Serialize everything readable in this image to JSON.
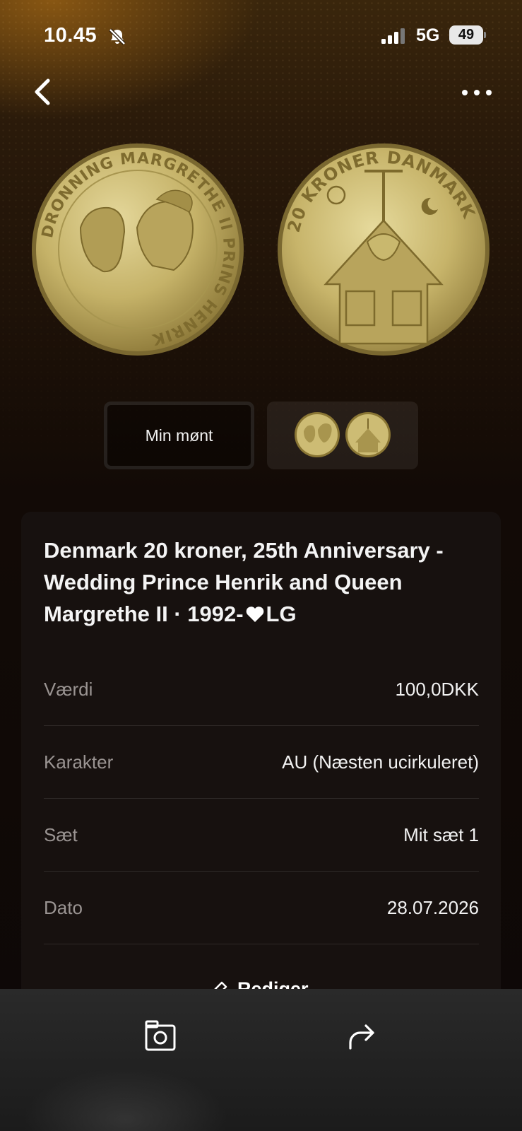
{
  "status_bar": {
    "time": "10.45",
    "network": "5G",
    "battery": "49",
    "icons": [
      "bell-slash-icon",
      "signal-icon",
      "battery-icon"
    ]
  },
  "nav": {
    "icons": [
      "chevron-left-icon",
      "ellipsis-icon"
    ]
  },
  "coin_images": {
    "obverse_inscription": "DRONNING MARGRETHE II PRINS HENRIK",
    "reverse_inscription": "20 KRONER DANMARK"
  },
  "toggle": {
    "my_coin_label": "Min mønt"
  },
  "coin": {
    "title_part1": "Denmark 20 kroner, 25th Anniversary - Wedding Prince Henrik and Queen Margrethe II · 1992-",
    "title_part2": "LG",
    "details": [
      {
        "label": "Værdi",
        "value": "100,0DKK"
      },
      {
        "label": "Karakter",
        "value": "AU (Næsten ucirkuleret)"
      },
      {
        "label": "Sæt",
        "value": "Mit sæt 1"
      },
      {
        "label": "Dato",
        "value": "28.07.2026"
      }
    ],
    "edit_label": "Rediger"
  },
  "bottom_bar": {
    "icons": [
      "camera-icon",
      "share-icon"
    ]
  },
  "colors": {
    "background_top": "#3a260c",
    "background_bottom": "#0d0807",
    "card": "#181210",
    "label_gray": "#9a9492",
    "gold": "#c8b46a"
  }
}
